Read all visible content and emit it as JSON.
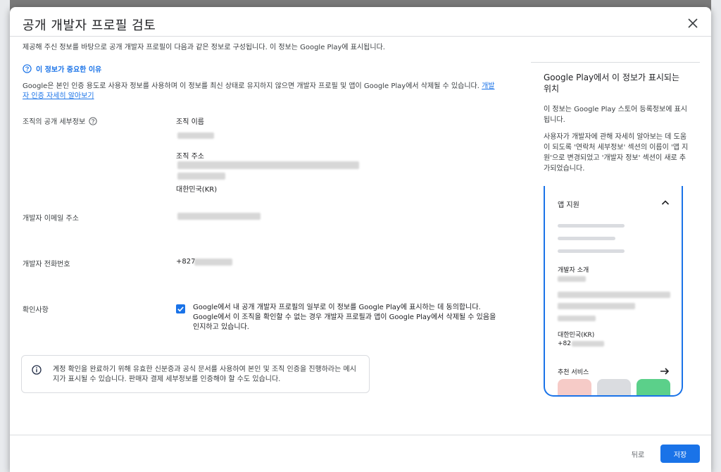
{
  "dialog": {
    "title": "공개 개발자 프로필 검토",
    "intro": "제공해 주신 정보를 바탕으로 공개 개발자 프로필이 다음과 같은 정보로 구성됩니다. 이 정보는 Google Play에 표시됩니다.",
    "why_link": "이 정보가 중요한 이유",
    "google_desc": "Google은 본인 인증 용도로 사용자 정보를 사용하며 이 정보를 최신 상태로 유지하지 않으면 개발자 프로필 및 앱이 Google Play에서 삭제될 수 있습니다.",
    "learn_more": "개발자 인증 자세히 알아보기"
  },
  "org": {
    "label": "조직의 공개 세부정보",
    "name_label": "조직 이름",
    "address_label": "조직 주소",
    "country": "대한민국(KR)"
  },
  "email": {
    "label": "개발자 이메일 주소"
  },
  "phone": {
    "label": "개발자 전화번호",
    "prefix": "+827"
  },
  "confirm": {
    "label": "확인사항",
    "text": "Google에서 내 공개 개발자 프로필의 일부로 이 정보를 Google Play에 표시하는 데 동의합니다. Google에서 이 조직을 확인할 수 없는 경우 개발자 프로필과 앱이 Google Play에서 삭제될 수 있음을 인지하고 있습니다.",
    "checked": true
  },
  "info": {
    "text": "계정 확인을 완료하기 위해 유효한 신분증과 공식 문서를 사용하여 본인 및 조직 인증을 진행하라는 메시지가 표시될 수 있습니다. 판매자 결제 세부정보를 인증해야 할 수도 있습니다."
  },
  "sidebar": {
    "heading": "Google Play에서 이 정보가 표시되는 위치",
    "p1": "이 정보는 Google Play 스토어 등록정보에 표시됩니다.",
    "p2": "사용자가 개발자에 관해 자세히 알아보는 데 도움이 되도록 '연락처 세부정보' 섹션의 이름이 '앱 지원'으로 변경되었고 '개발자 정보' 섹션이 새로 추가되었습니다.",
    "preview": {
      "section_title": "앱 지원",
      "about_label": "개발자 소개",
      "country": "대한민국(KR)",
      "phone_prefix": "+82",
      "recommended": "추천 서비스",
      "tile_colors": [
        "#f6cbc7",
        "#dadce0",
        "#5bd08a"
      ]
    }
  },
  "footer": {
    "back": "뒤로",
    "save": "저장"
  },
  "colors": {
    "accent": "#1a73e8"
  }
}
